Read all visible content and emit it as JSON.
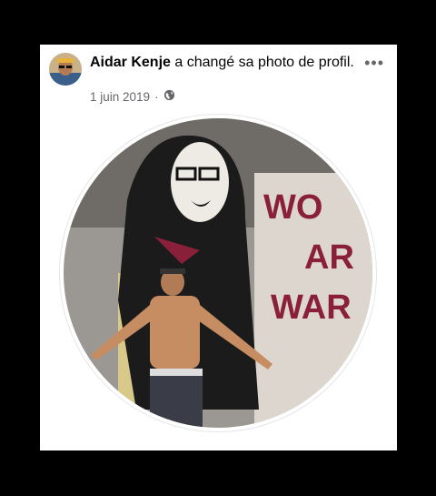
{
  "post": {
    "author": "Aidar Kenje",
    "action": " a changé sa photo de profil.",
    "date": "1 juin 2019",
    "separator": "·",
    "audience_icon": "globe-icon",
    "more_icon": "more-options-icon",
    "more_label": "•••",
    "mural_text": [
      "WO",
      "AR",
      "WAR"
    ]
  },
  "colors": {
    "card": "#ffffff",
    "backdrop": "#000000",
    "mural_text": "#8a1f3a"
  }
}
